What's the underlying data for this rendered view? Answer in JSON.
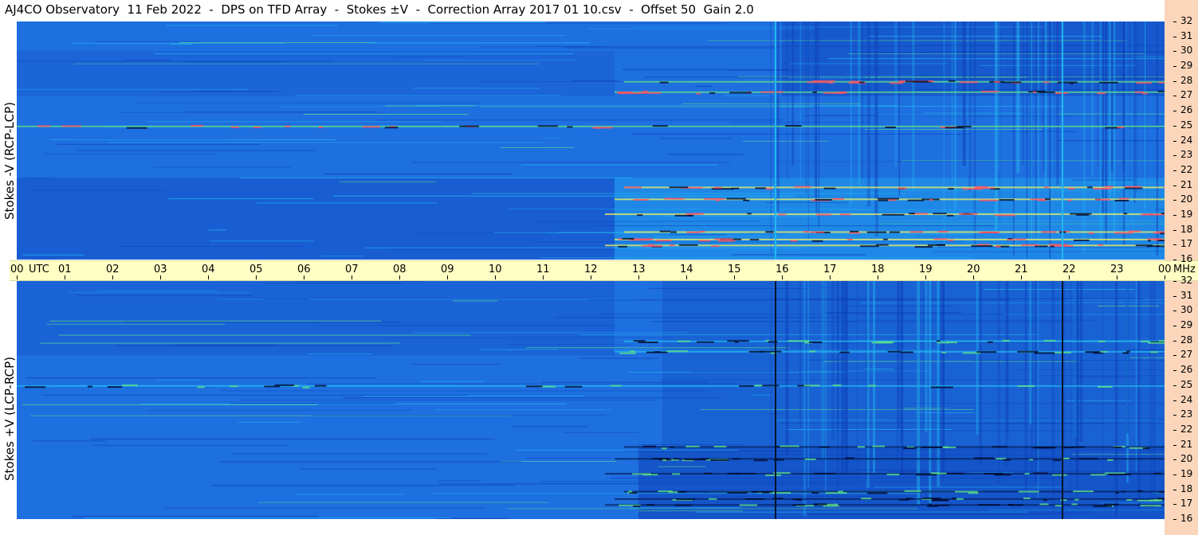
{
  "header": {
    "title": "AJ4CO Observatory  11 Feb 2022  -  DPS on TFD Array  -  Stokes ±V  -  Correction Array 2017 01 10.csv  -  Offset 50  Gain 2.0"
  },
  "colors": {
    "background_blue": "#1e6fe0",
    "deep_blue": "#0d3fb8",
    "cyan": "#22b8f0",
    "green": "#5ee08a",
    "yellow": "#f0f060",
    "time_bar": "#ffffc4",
    "right_strip": "#fbd6bb"
  },
  "chart_data": [
    {
      "type": "heatmap",
      "panel": "top",
      "ylabel": "Stokes -V (RCP-LCP)",
      "y_unit": "MHz",
      "ylim": [
        16,
        32
      ],
      "y_ticks": [
        "16",
        "17",
        "18",
        "19",
        "20",
        "21",
        "22",
        "23",
        "24",
        "25",
        "26",
        "27",
        "28",
        "29",
        "30",
        "31",
        "32"
      ],
      "x_ticks": [
        "00",
        "UTC",
        "01",
        "02",
        "03",
        "04",
        "05",
        "06",
        "07",
        "08",
        "09",
        "10",
        "11",
        "12",
        "13",
        "14",
        "15",
        "16",
        "17",
        "18",
        "19",
        "20",
        "21",
        "22",
        "23",
        "00"
      ],
      "xlim_hours": [
        0,
        24
      ],
      "vertical_lines_hours": [
        15.85,
        21.85
      ],
      "strong_bands_mhz": [
        17.0,
        17.4,
        17.9,
        19.1,
        20.1,
        20.9,
        25.0,
        27.3,
        28.0
      ]
    },
    {
      "type": "heatmap",
      "panel": "bottom",
      "ylabel": "Stokes +V (LCP-RCP)",
      "y_unit": "MHz",
      "ylim": [
        16,
        32
      ],
      "y_ticks": [
        "16",
        "17",
        "18",
        "19",
        "20",
        "21",
        "22",
        "23",
        "24",
        "25",
        "26",
        "27",
        "28",
        "29",
        "30",
        "31",
        "32"
      ],
      "xlim_hours": [
        0,
        24
      ],
      "vertical_lines_hours": [
        15.85,
        21.85
      ],
      "strong_bands_mhz": [
        17.0,
        17.4,
        17.9,
        19.1,
        20.1,
        20.9,
        25.0,
        27.3,
        28.0
      ]
    }
  ],
  "time_axis": {
    "labels": [
      "00",
      "UTC",
      "01",
      "02",
      "03",
      "04",
      "05",
      "06",
      "07",
      "08",
      "09",
      "10",
      "11",
      "12",
      "13",
      "14",
      "15",
      "16",
      "17",
      "18",
      "19",
      "20",
      "21",
      "22",
      "23",
      "00",
      "MHz"
    ]
  }
}
